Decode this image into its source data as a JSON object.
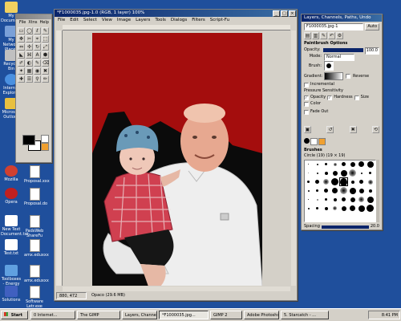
{
  "desktop": {
    "icons": [
      {
        "label": "My Documents",
        "icon": "folder-icon",
        "color": "#f0d060"
      },
      {
        "label": "My Network Places",
        "icon": "network-icon",
        "color": "#7aa0d8"
      },
      {
        "label": "Recycle Bin",
        "icon": "recycle-bin-icon",
        "color": "#c0c0c0"
      },
      {
        "label": "Internet Explorer",
        "icon": "browser-icon",
        "color": "#4a90e0"
      },
      {
        "label": "Microsoft Outlook",
        "icon": "mail-icon",
        "color": "#e8c040"
      },
      {
        "label": "Mozilla",
        "icon": "browser-icon",
        "color": "#d04030"
      },
      {
        "label": "Opera",
        "icon": "browser-icon",
        "color": "#c02020"
      },
      {
        "label": "New Text Document.txt",
        "icon": "text-file-icon",
        "color": "#ffffff"
      },
      {
        "label": "Test.txt",
        "icon": "text-file-icon",
        "color": "#ffffff"
      },
      {
        "label": "Toolboxes - Energy To...",
        "icon": "shortcut-icon",
        "color": "#60a0e0"
      },
      {
        "label": "Solutions",
        "icon": "shortcut-icon",
        "color": "#4060c0"
      }
    ],
    "icons2": [
      {
        "label": "Proposal.xxx",
        "icon": "document-icon"
      },
      {
        "label": "Proposal.do",
        "icon": "document-icon"
      },
      {
        "label": "PadsWeb ShareFu",
        "icon": "document-icon"
      },
      {
        "label": "amx.eduxxx",
        "icon": "document-icon"
      },
      {
        "label": "amx.eduxxx",
        "icon": "document-icon"
      },
      {
        "label": "Software Letr.exe",
        "icon": "document-icon"
      }
    ]
  },
  "toolbox": {
    "menu": [
      "File",
      "Xtns",
      "Help"
    ],
    "tools": [
      "▭",
      "◯",
      "ℓ",
      "✎",
      "✥",
      "✂",
      "⌖",
      "⬚",
      "⇔",
      "✣",
      "↻",
      "⤢",
      "◣",
      "⌘",
      "A",
      "⬢",
      "✐",
      "◐",
      "✎",
      "⌫",
      "✦",
      "▦",
      "◉",
      "✖",
      "✚",
      "☰",
      "⚲",
      "✏"
    ]
  },
  "image_window": {
    "title": "*F1000035.jpg-1.0 (RGB, 1 layer) 100%",
    "menu": [
      "File",
      "Edit",
      "Select",
      "View",
      "Image",
      "Layers",
      "Tools",
      "Dialogs",
      "Filters",
      "Script-Fu"
    ],
    "status_left": "880, 472",
    "status_right": "Opaco (29.6 MB)",
    "colors": {
      "canvas_bg": "#d4d0c8",
      "background": "#a40d0d",
      "shadow": "#0b0b0b"
    }
  },
  "layers_dialog": {
    "title": "Layers, Channels, Paths, Undo",
    "image_select": "F1000035.jpg-1",
    "auto_label": "Auto",
    "section_title": "Paintbrush Options",
    "opacity_label": "Opacity:",
    "opacity_value": "100.0",
    "mode_label": "Mode:",
    "mode_value": "Normal",
    "brush_label": "Brush:",
    "gradient_label": "Gradient:",
    "reverse_label": "Reverse",
    "incremental_label": "Incremental",
    "pressure_label": "Pressure Sensitivity",
    "opt_opacity": "Opacity",
    "opt_hardness": "Hardness",
    "opt_size": "Size",
    "opt_color": "Color",
    "fade_label": "Fade Out",
    "brushes_title": "Brushes",
    "brush_name": "Circle (19) (19 × 19)",
    "spacing_label": "Spacing",
    "spacing_value": "20.0"
  },
  "taskbar": {
    "start": "Start",
    "tasks": [
      "0 Internet...",
      "The GIMP",
      "Layers, Channel...",
      "*F1000035.jpg...",
      "GIMP 2",
      "Adobe Photoshop",
      "5. Starcatch - ..."
    ],
    "clock": "8:41 PM"
  }
}
